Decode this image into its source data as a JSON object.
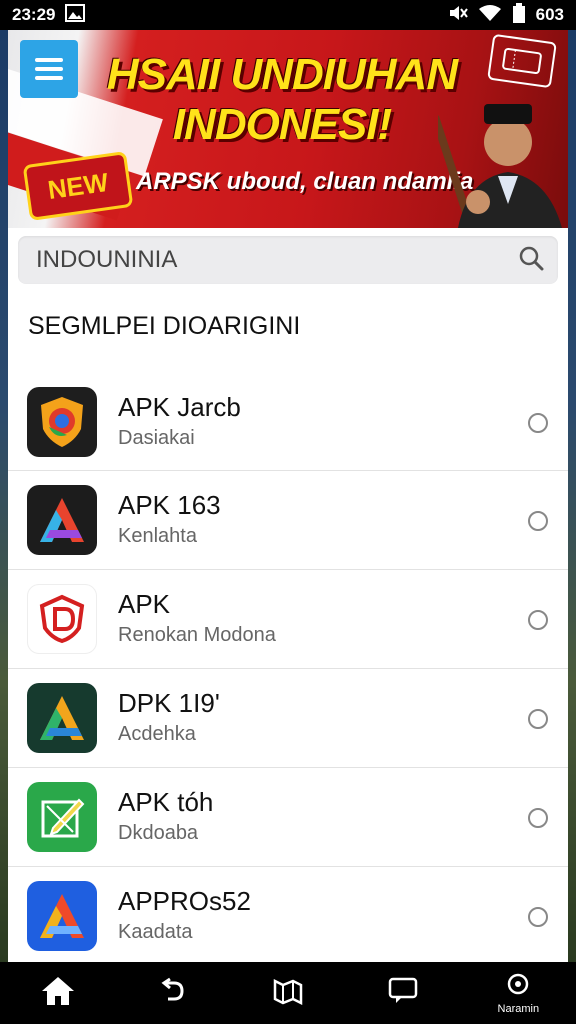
{
  "status_bar": {
    "time": "23:29",
    "battery_text": "603",
    "icons": [
      "gallery-icon",
      "mute-icon",
      "wifi-icon",
      "battery-icon"
    ]
  },
  "banner": {
    "title_line1": "HSAII UNDIUHAN",
    "title_line2": "INDONESI!",
    "subtitle": "ARPSK uboud, cluan ndamlia",
    "badge": "NEW",
    "colors": {
      "red": "#c7171a",
      "yellow": "#ffe21a",
      "menu_blue": "#2da4e6"
    }
  },
  "search": {
    "value": "INDOUNINIA"
  },
  "section": {
    "title": "SEGMLPEI DIOARIGINI"
  },
  "apps": [
    {
      "name": "APK Jarcb",
      "subtitle": "Dasiakai",
      "icon": "chrome-shield-icon"
    },
    {
      "name": "APK 163",
      "subtitle": "Kenlahta",
      "icon": "gradient-a-icon"
    },
    {
      "name": "APK",
      "subtitle": "Renokan Modona",
      "icon": "red-shield-d-icon"
    },
    {
      "name": "DPK 1I9'",
      "subtitle": "Acdehka",
      "icon": "green-a-icon"
    },
    {
      "name": "APK tóh",
      "subtitle": "Dkdoaba",
      "icon": "green-edit-icon"
    },
    {
      "name": "APPROs52",
      "subtitle": "Kaadata",
      "icon": "blue-a-icon"
    }
  ],
  "nav": {
    "items": [
      {
        "icon": "home-icon"
      },
      {
        "icon": "back-arrow-icon"
      },
      {
        "icon": "map-icon"
      },
      {
        "icon": "chat-icon"
      },
      {
        "icon": "settings-icon",
        "label": "Naramin"
      }
    ]
  }
}
